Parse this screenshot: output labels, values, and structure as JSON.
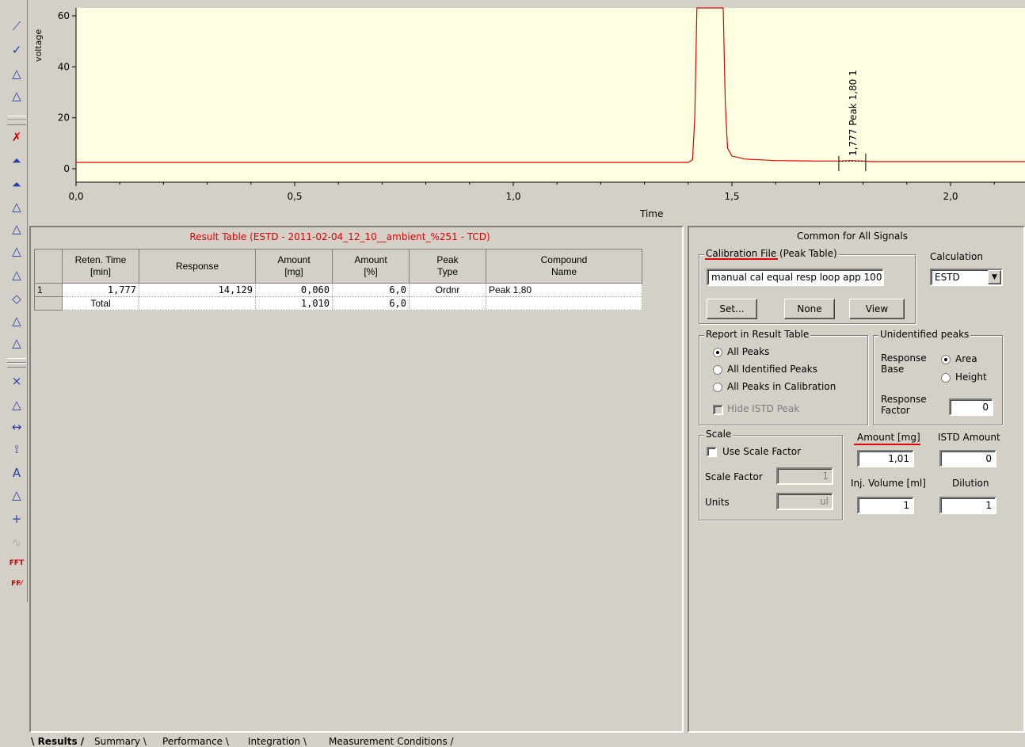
{
  "chart_data": {
    "type": "line",
    "ylabel": "voltage",
    "xlabel": "Time",
    "xticks": [
      "0,0",
      "0,5",
      "1,0",
      "1,5",
      "2,0"
    ],
    "yticks": [
      "0",
      "20",
      "40",
      "60"
    ],
    "xlim": [
      0.0,
      2.2
    ],
    "ylim": [
      -3,
      63
    ],
    "series": [
      {
        "color": "#e00000",
        "x": [
          0.0,
          1.4,
          1.41,
          1.415,
          1.42,
          1.48,
          1.485,
          1.49,
          1.5,
          1.53,
          1.6,
          1.7,
          1.75,
          1.77,
          1.8,
          1.82,
          2.2
        ],
        "y": [
          2.5,
          2.5,
          3.5,
          20,
          70,
          70,
          25,
          8,
          5,
          3.8,
          3.2,
          3.0,
          3.0,
          3.2,
          3.0,
          2.8,
          2.8
        ]
      }
    ],
    "annotations": [
      {
        "x": 1.777,
        "text": "1,777 Peak 1,80",
        "marker": "1"
      }
    ],
    "background": "#ffffe1"
  },
  "result_table": {
    "title": "Result Table (ESTD - 2011-02-04_12_10__ambient_%251 - TCD)",
    "headers": [
      [
        "",
        ""
      ],
      [
        "Reten. Time",
        "[min]"
      ],
      [
        "Response",
        ""
      ],
      [
        "Amount",
        "[mg]"
      ],
      [
        "Amount",
        "[%]"
      ],
      [
        "Peak",
        "Type"
      ],
      [
        "Compound",
        "Name"
      ]
    ],
    "rows": [
      {
        "label": "1",
        "ret_time": "1,777",
        "response": "14,129",
        "amount_mg": "0,060",
        "amount_pct": "6,0",
        "peak_type": "Ordnr",
        "compound": "Peak 1,80"
      },
      {
        "label": "",
        "ret_time": "Total",
        "response": "",
        "amount_mg": "1,010",
        "amount_pct": "6,0",
        "peak_type": "",
        "compound": ""
      }
    ]
  },
  "right_panel": {
    "title": "Common for All Signals",
    "calibration_file": {
      "title": "Calibration File (Peak Table)",
      "value": "manual cal equal resp loop app 100",
      "set_label": "Set...",
      "none_label": "None",
      "view_label": "View"
    },
    "calculation": {
      "label": "Calculation",
      "value": "ESTD"
    },
    "report": {
      "title": "Report in Result Table",
      "options": [
        "All Peaks",
        "All Identified Peaks",
        "All Peaks in Calibration"
      ],
      "selected": 0,
      "hide_istd": "Hide ISTD Peak"
    },
    "unidentified": {
      "title": "Unidentified peaks",
      "response_base": "Response Base",
      "area": "Area",
      "height": "Height",
      "response_factor": "Response Factor",
      "response_factor_value": "0"
    },
    "scale": {
      "title": "Scale",
      "use_scale_factor": "Use Scale Factor",
      "scale_factor_label": "Scale Factor",
      "scale_factor_value": "1",
      "units_label": "Units",
      "units_value": "ul"
    },
    "amount": {
      "label": "Amount [mg]",
      "value": "1,01"
    },
    "istd_amount": {
      "label": "ISTD Amount",
      "value": "0"
    },
    "inj_volume": {
      "label": "Inj. Volume [ml]",
      "value": "1"
    },
    "dilution": {
      "label": "Dilution",
      "value": "1"
    }
  },
  "tabs": [
    "Results",
    "Summary",
    "Performance",
    "Integration",
    "Measurement Conditions"
  ],
  "active_tab": 0
}
